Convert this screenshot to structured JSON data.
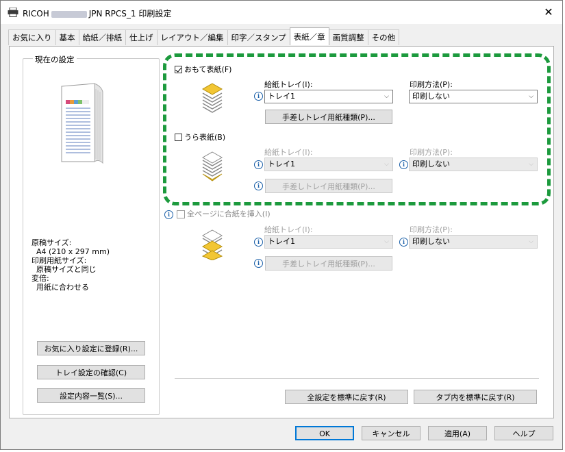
{
  "window": {
    "title_prefix": "RICOH",
    "title_suffix": "JPN RPCS_1 印刷設定",
    "close_glyph": "✕"
  },
  "tabs": [
    {
      "label": "お気に入り"
    },
    {
      "label": "基本"
    },
    {
      "label": "給紙／排紙"
    },
    {
      "label": "仕上げ"
    },
    {
      "label": "レイアウト／編集"
    },
    {
      "label": "印字／スタンプ"
    },
    {
      "label": "表紙／章",
      "active": true
    },
    {
      "label": "画質調整"
    },
    {
      "label": "その他"
    }
  ],
  "current_settings": {
    "label": "現在の設定",
    "original_size_label": "原稿サイズ:",
    "original_size_value": "A4 (210 x 297 mm)",
    "print_paper_size_label": "印刷用紙サイズ:",
    "print_paper_size_value": "原稿サイズと同じ",
    "scaling_label": "変倍:",
    "scaling_value": "用紙に合わせる",
    "register_favorite_button": "お気に入り設定に登録(R)...",
    "tray_settings_button": "トレイ設定の確認(C)",
    "settings_list_button": "設定内容一覧(S)..."
  },
  "front_cover": {
    "checkbox_label": "おもて表紙(F)",
    "checked": true,
    "tray_label": "給紙トレイ(I):",
    "tray_value": "トレイ1",
    "print_method_label": "印刷方法(P):",
    "print_method_value": "印刷しない",
    "bypass_button": "手差しトレイ用紙種類(P)..."
  },
  "back_cover": {
    "checkbox_label": "うら表紙(B)",
    "checked": false,
    "tray_label": "給紙トレイ(I):",
    "tray_value": "トレイ1",
    "print_method_label": "印刷方法(P):",
    "print_method_value": "印刷しない",
    "bypass_button": "手差しトレイ用紙種類(P)..."
  },
  "insert_section": {
    "partial_label": "全ページに合紙を挿入(I)",
    "tray_label": "給紙トレイ(I):",
    "tray_value": "トレイ1",
    "print_method_label": "印刷方法(P):",
    "print_method_value": "印刷しない",
    "bypass_button": "手差しトレイ用紙種類(P)..."
  },
  "footer": {
    "reset_all_button": "全設定を標準に戻す(R)",
    "reset_tab_button": "タブ内を標準に戻す(R)",
    "ok_button": "OK",
    "cancel_button": "キャンセル",
    "apply_button": "適用(A)",
    "help_button": "ヘルプ"
  },
  "colors": {
    "highlight_dash": "#1c9a3d",
    "accent_blue": "#0078d7"
  }
}
